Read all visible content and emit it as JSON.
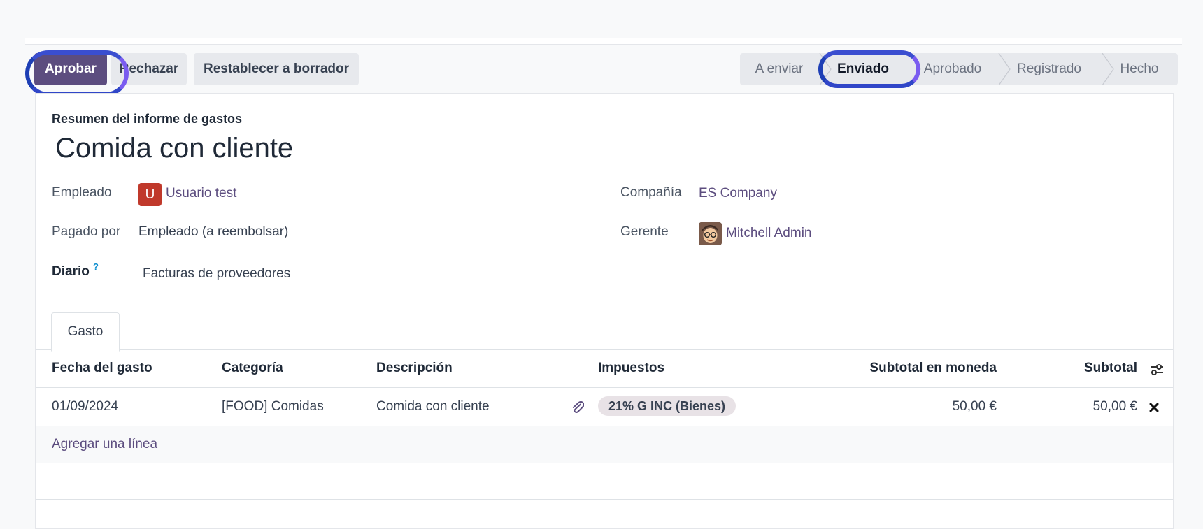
{
  "toolbar": {
    "approve_label": "Aprobar",
    "reject_label": "Rechazar",
    "reset_label": "Restablecer a borrador"
  },
  "statusbar": {
    "stages": [
      "A enviar",
      "Enviado",
      "Aprobado",
      "Registrado",
      "Hecho"
    ],
    "active": "Enviado"
  },
  "form": {
    "subtitle": "Resumen del informe de gastos",
    "title": "Comida con cliente",
    "employee_label": "Empleado",
    "employee_avatar_letter": "U",
    "employee_value": "Usuario test",
    "paid_by_label": "Pagado por",
    "paid_by_value": "Empleado (a reembolsar)",
    "journal_label": "Diario",
    "journal_help": "?",
    "journal_value": "Facturas de proveedores",
    "company_label": "Compañía",
    "company_value": "ES Company",
    "manager_label": "Gerente",
    "manager_value": "Mitchell Admin"
  },
  "tabs": [
    "Gasto"
  ],
  "table": {
    "headers": [
      "Fecha del gasto",
      "Categoría",
      "Descripción",
      "Impuestos",
      "Subtotal en moneda",
      "Subtotal"
    ],
    "rows": [
      {
        "date": "01/09/2024",
        "category": "[FOOD] Comidas",
        "description": "Comida con cliente",
        "tax": "21% G INC (Bienes)",
        "subtotal_currency": "50,00 €",
        "subtotal": "50,00 €"
      }
    ],
    "add_line": "Agregar una línea"
  },
  "icons": {
    "attachment": "paperclip-icon",
    "delete": "close-icon",
    "settings": "sliders-icon"
  },
  "colors": {
    "primary": "#5c4d7f",
    "highlight": "#7a5cf0",
    "avatar_bg": "#c0392b"
  }
}
